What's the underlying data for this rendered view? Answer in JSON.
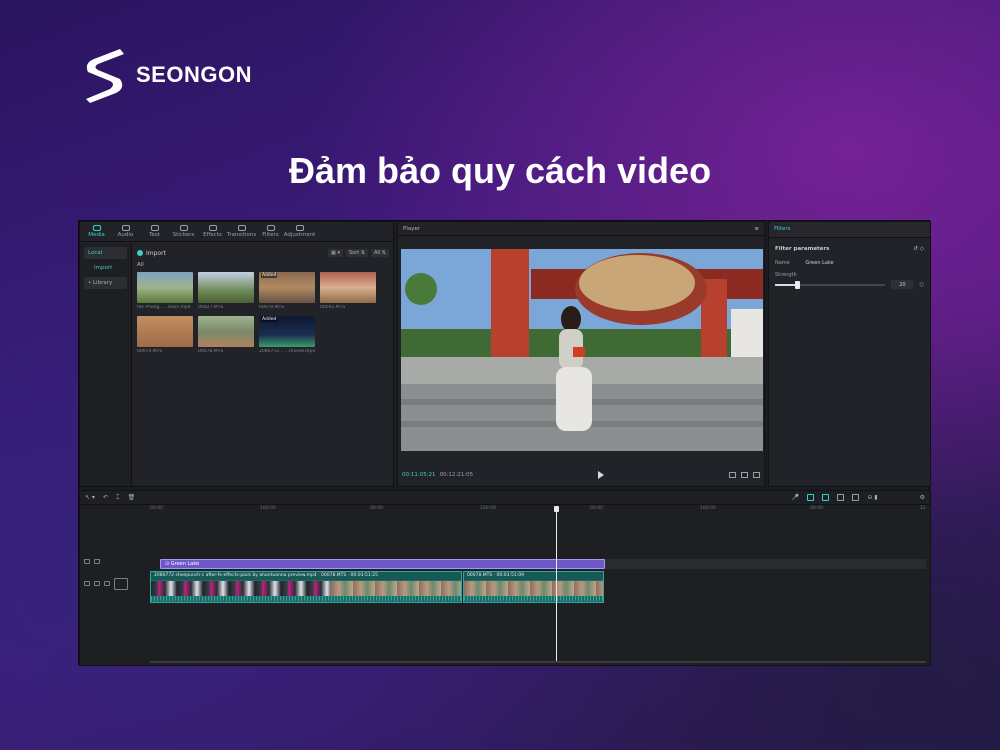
{
  "brand": {
    "name": "SEONGON",
    "accent": "#3ad1c9"
  },
  "headline": "Đảm bảo quy cách video",
  "editor": {
    "tabs": [
      {
        "label": "Media",
        "icon": "media-icon",
        "active": true
      },
      {
        "label": "Audio",
        "icon": "audio-icon"
      },
      {
        "label": "Text",
        "icon": "text-icon"
      },
      {
        "label": "Stickers",
        "icon": "stickers-icon"
      },
      {
        "label": "Effects",
        "icon": "effects-icon"
      },
      {
        "label": "Transitions",
        "icon": "transitions-icon"
      },
      {
        "label": "Filters",
        "icon": "filters-icon"
      },
      {
        "label": "Adjustment",
        "icon": "adjustment-icon"
      }
    ],
    "side_items": [
      "Local",
      "Import",
      "• Library"
    ],
    "import_label": "Import",
    "sort_label": "Sort",
    "all_filter": "All",
    "all_label": "All",
    "media_items": [
      {
        "caption": "file Phong... ..main.mp4",
        "added": "",
        "style": "t1"
      },
      {
        "caption": "00027.MTS",
        "added": "",
        "style": "t2"
      },
      {
        "caption": "00070.MTS",
        "added": "Added",
        "style": "t3"
      },
      {
        "caption": "00041.MTS",
        "added": "",
        "style": "t4"
      },
      {
        "caption": "00074.MTS",
        "added": "",
        "style": "t5"
      },
      {
        "caption": "00078.MTS",
        "added": "",
        "style": "t6"
      },
      {
        "caption": "2080772... ...review.mp4",
        "added": "Added",
        "style": "t7"
      }
    ],
    "player": {
      "title": "Player",
      "time_current": "00:11:05:21",
      "time_total": "00:12:21:05"
    },
    "filters": {
      "title": "Filters",
      "section": "Filter parameters",
      "name_label": "Name",
      "name_value": "Green Lake",
      "strength_label": "Strength",
      "strength_value": "20",
      "strength_fraction": 0.2
    },
    "timeline": {
      "ruler": [
        "00:00",
        "100:00",
        "00:00",
        "100:00",
        "00:00",
        "100:00",
        "00:00",
        "12"
      ],
      "filter_clip": "Green Lake",
      "clips": [
        {
          "label": "2080772 sheepunch-c after-fx-effects-pack by ahantuanna preview.mp4 · 00078.MTS · 00:03:51:25",
          "kind": "dark"
        },
        {
          "label": "00078.MTS · 00:03:51:09",
          "kind": "light"
        }
      ]
    }
  }
}
